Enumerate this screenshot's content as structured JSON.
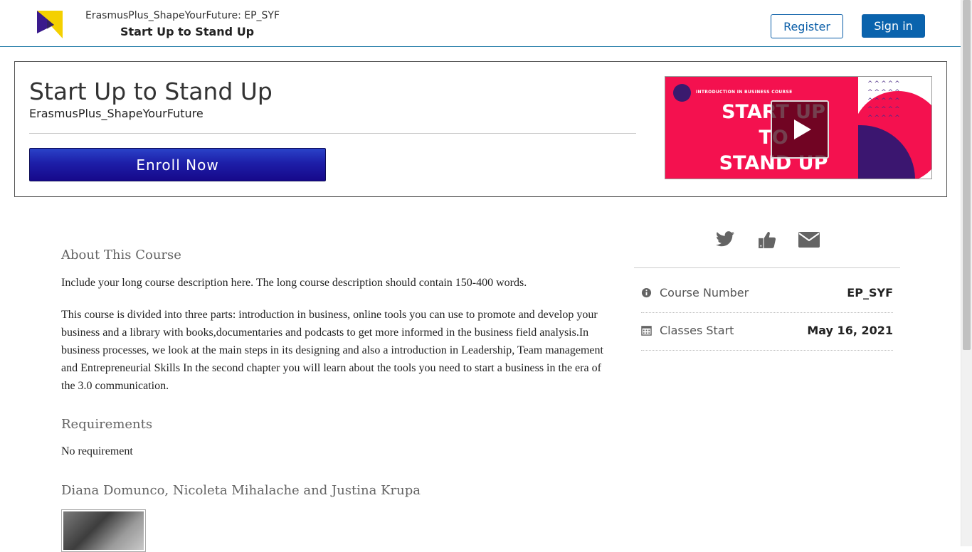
{
  "header": {
    "org_line": "ErasmusPlus_ShapeYourFuture: EP_SYF",
    "course_line": "Start Up to Stand Up",
    "register_label": "Register",
    "signin_label": "Sign in",
    "logo_colors": [
      "#f4d000",
      "#3a1a8c"
    ]
  },
  "hero": {
    "title": "Start Up to Stand Up",
    "org": "ErasmusPlus_ShapeYourFuture",
    "enroll_label": "Enroll Now",
    "video": {
      "small_caption": "INTRODUCTION IN BUSINESS COURSE",
      "big_text_1": "START UP",
      "big_text_2": "TO",
      "big_text_3": "STAND UP",
      "play_icon": "play-icon",
      "accent": "#f4114f",
      "purple": "#3b1670"
    }
  },
  "about": {
    "heading": "About This Course",
    "paragraph1": "Include your long course description here. The long course description should contain 150-400 words.",
    "paragraph2": "This course is divided into three parts: introduction in business, online tools you can use to promote and develop your business and a library with books,documentaries and podcasts to get more informed in the business field analysis.In business processes, we look at the main steps in its designing and also a introduction in Leadership, Team management and Entrepreneurial Skills In the second chapter you will learn about the tools you need to start a business in the era of the 3.0 communication."
  },
  "requirements": {
    "heading": "Requirements",
    "text": "No requirement"
  },
  "staff": {
    "heading": "Diana Domunco, Nicoleta Mihalache and Justina Krupa"
  },
  "share": {
    "icons": [
      "twitter-icon",
      "thumbs-up-icon",
      "envelope-icon"
    ]
  },
  "info": [
    {
      "icon": "info-icon",
      "label": "Course Number",
      "value": "EP_SYF"
    },
    {
      "icon": "calendar-icon",
      "label": "Classes Start",
      "value": "May 16, 2021"
    }
  ]
}
